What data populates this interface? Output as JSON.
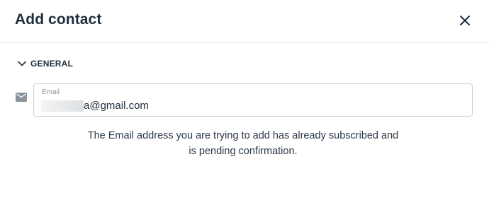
{
  "dialog": {
    "title": "Add contact",
    "close_icon": "close-icon"
  },
  "section": {
    "label": "GENERAL",
    "icon": "chevron-down-icon"
  },
  "email_field": {
    "icon": "mail-icon",
    "label": "Email",
    "value_visible": "a@gmail.com"
  },
  "message": {
    "line1": "The Email address you are trying to add has already subscribed and",
    "line2": "is pending confirmation."
  }
}
